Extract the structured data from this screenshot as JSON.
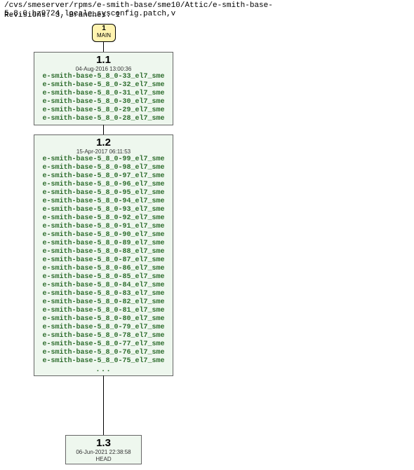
{
  "header": {
    "path": "/cvs/smeserver/rpms/e-smith-base/sme10/Attic/e-smith-base-5.8.0.bz9724.locale_sysconfig.patch,v",
    "meta": "Revisions: 3, Branches: 1"
  },
  "branch": {
    "number": "1",
    "name": "MAIN"
  },
  "nodes": {
    "r11": {
      "rev": "1.1",
      "date": "04-Aug-2016 13:00:36",
      "tags": [
        "e-smith-base-5_8_0-33_el7_sme",
        "e-smith-base-5_8_0-32_el7_sme",
        "e-smith-base-5_8_0-31_el7_sme",
        "e-smith-base-5_8_0-30_el7_sme",
        "e-smith-base-5_8_0-29_el7_sme",
        "e-smith-base-5_8_0-28_el7_sme"
      ]
    },
    "r12": {
      "rev": "1.2",
      "date": "15-Apr-2017 06:11:53",
      "tags": [
        "e-smith-base-5_8_0-99_el7_sme",
        "e-smith-base-5_8_0-98_el7_sme",
        "e-smith-base-5_8_0-97_el7_sme",
        "e-smith-base-5_8_0-96_el7_sme",
        "e-smith-base-5_8_0-95_el7_sme",
        "e-smith-base-5_8_0-94_el7_sme",
        "e-smith-base-5_8_0-93_el7_sme",
        "e-smith-base-5_8_0-92_el7_sme",
        "e-smith-base-5_8_0-91_el7_sme",
        "e-smith-base-5_8_0-90_el7_sme",
        "e-smith-base-5_8_0-89_el7_sme",
        "e-smith-base-5_8_0-88_el7_sme",
        "e-smith-base-5_8_0-87_el7_sme",
        "e-smith-base-5_8_0-86_el7_sme",
        "e-smith-base-5_8_0-85_el7_sme",
        "e-smith-base-5_8_0-84_el7_sme",
        "e-smith-base-5_8_0-83_el7_sme",
        "e-smith-base-5_8_0-82_el7_sme",
        "e-smith-base-5_8_0-81_el7_sme",
        "e-smith-base-5_8_0-80_el7_sme",
        "e-smith-base-5_8_0-79_el7_sme",
        "e-smith-base-5_8_0-78_el7_sme",
        "e-smith-base-5_8_0-77_el7_sme",
        "e-smith-base-5_8_0-76_el7_sme",
        "e-smith-base-5_8_0-75_el7_sme"
      ],
      "ellipsis": "..."
    },
    "r13": {
      "rev": "1.3",
      "date": "06-Jun-2021 22:38:58",
      "branch_tag": "HEAD"
    }
  }
}
